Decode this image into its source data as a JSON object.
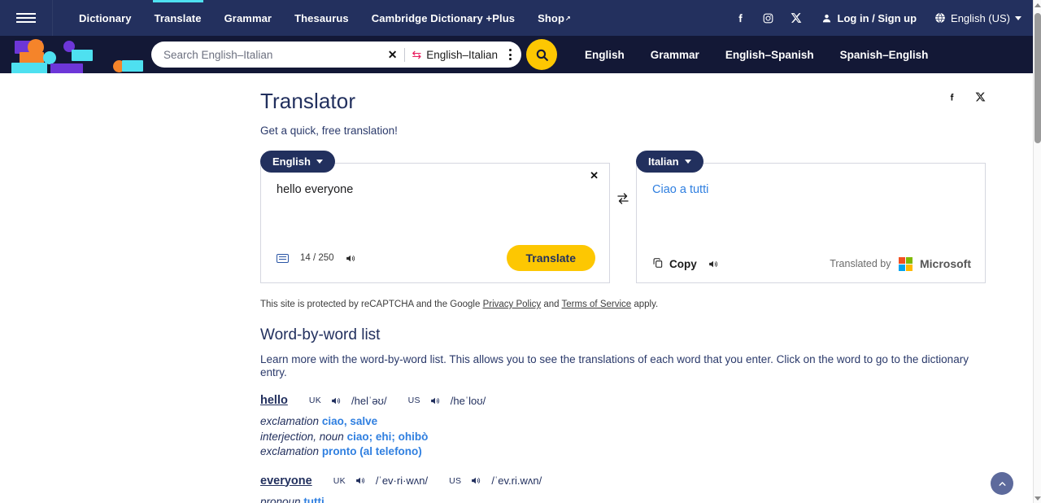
{
  "topnav": {
    "menu_icon": "hamburger-icon",
    "links": [
      {
        "label": "Dictionary",
        "active": false
      },
      {
        "label": "Translate",
        "active": true
      },
      {
        "label": "Grammar",
        "active": false
      },
      {
        "label": "Thesaurus",
        "active": false
      },
      {
        "label": "Cambridge Dictionary +Plus",
        "active": false
      },
      {
        "label": "Shop",
        "active": false,
        "external": true
      }
    ],
    "social": [
      "facebook-icon",
      "instagram-icon",
      "x-twitter-icon"
    ],
    "login_label": "Log in / Sign up",
    "language_label": "English (US)"
  },
  "search": {
    "placeholder": "Search English–Italian",
    "value": "",
    "clear_label": "✕",
    "dictionary_pair": "English–Italian",
    "swap_icon": "swap-horizontal-icon",
    "kebab_icon": "more-options-icon",
    "search_icon": "search-icon",
    "quicklinks": [
      "English",
      "Grammar",
      "English–Spanish",
      "Spanish–English"
    ]
  },
  "main": {
    "title": "Translator",
    "subtitle": "Get a quick, free translation!",
    "share": [
      "facebook-icon",
      "x-twitter-icon"
    ],
    "source": {
      "language": "English",
      "text": "hello everyone",
      "clear_icon": "close-icon",
      "keyboard_icon": "keyboard-icon",
      "counter": "14 / 250",
      "speaker_icon": "speaker-icon",
      "translate_button": "Translate"
    },
    "swap_icon": "swap-languages-icon",
    "target": {
      "language": "Italian",
      "text": "Ciao a tutti",
      "copy_label": "Copy",
      "copy_icon": "copy-icon",
      "speaker_icon": "speaker-icon",
      "translated_by": "Translated by",
      "provider": "Microsoft"
    },
    "recaptcha": {
      "prefix": "This site is protected by reCAPTCHA and the Google ",
      "privacy": "Privacy Policy",
      "middle": " and ",
      "terms": "Terms of Service",
      "suffix": " apply."
    },
    "wordbyword": {
      "heading": "Word-by-word list",
      "description": "Learn more with the word-by-word list. This allows you to see the translations of each word that you enter. Click on the word to go to the dictionary entry.",
      "entries": [
        {
          "word": "hello",
          "uk_label": "UK",
          "uk_ipa": "/helˈəʊ/",
          "us_label": "US",
          "us_ipa": "/heˈloʊ/",
          "senses": [
            {
              "pos": "exclamation",
              "translation": "ciao, salve"
            },
            {
              "pos": "interjection, noun",
              "translation": "ciao; ehi; ohibò"
            },
            {
              "pos": "exclamation",
              "translation": "pronto (al telefono)"
            }
          ]
        },
        {
          "word": "everyone",
          "uk_label": "UK",
          "uk_ipa": "/ˈev·ri·wʌn/",
          "us_label": "US",
          "us_ipa": "/ˈev.ri.wʌn/",
          "senses": [
            {
              "pos": "pronoun",
              "translation": "tutti"
            }
          ]
        }
      ]
    },
    "back_to_top": "back-to-top-icon"
  },
  "colors": {
    "nav_bg": "#23305e",
    "search_bg": "#131836",
    "accent_yellow": "#fdc702",
    "accent_cyan": "#4ee0f0",
    "link_blue": "#2f7fe0",
    "heading_navy": "#22305e",
    "pink": "#e8165a"
  }
}
